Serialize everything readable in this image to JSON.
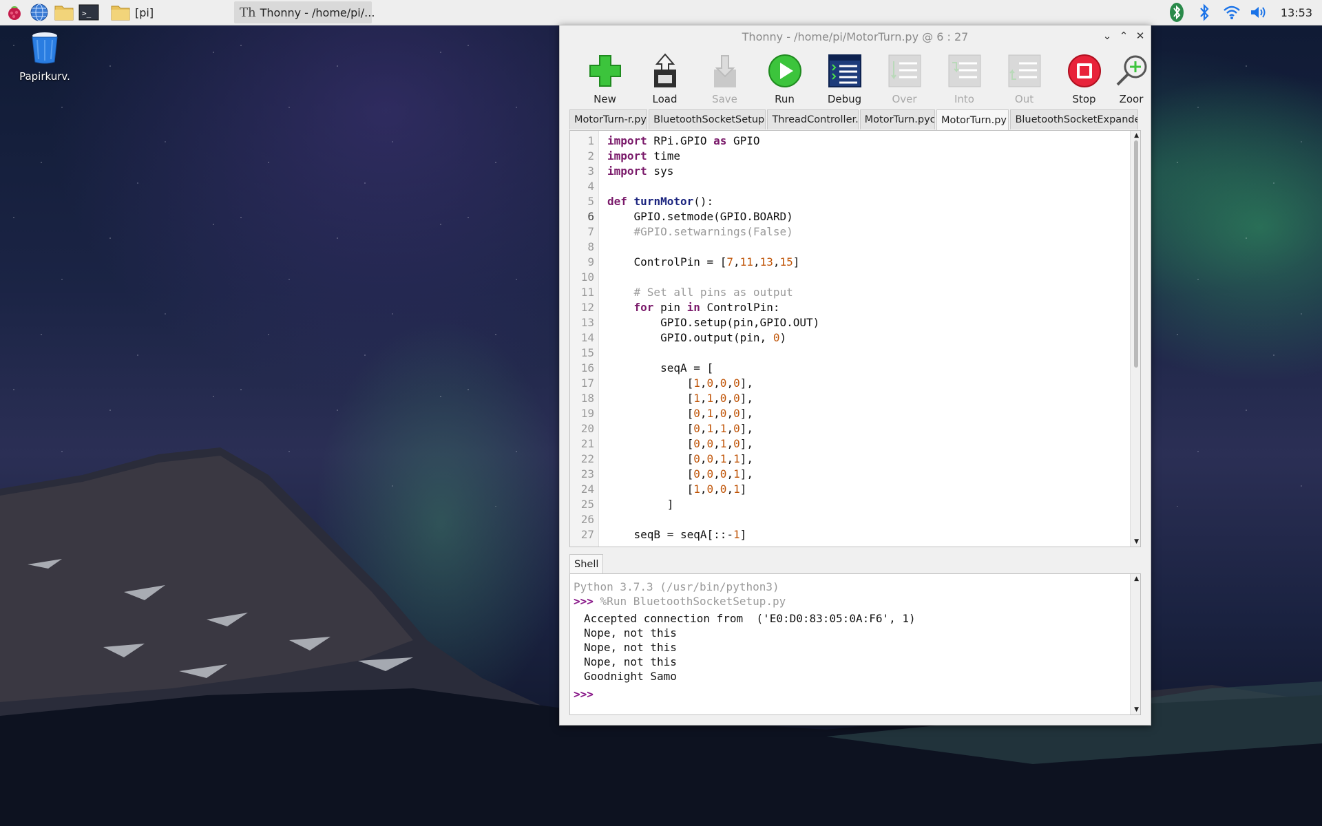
{
  "taskbar": {
    "folder_label": "[pi]",
    "task_label": "Thonny  -  /home/pi/...",
    "clock": "13:53",
    "icons": [
      "raspberry-menu-icon",
      "web-browser-icon",
      "file-manager-icon",
      "terminal-icon"
    ],
    "tray_icons": [
      "bluetooth-status-icon",
      "bluetooth-icon",
      "wifi-icon",
      "volume-icon"
    ]
  },
  "desktop": {
    "trash_label": "Papirkurv."
  },
  "window": {
    "title": "Thonny  -  /home/pi/MotorTurn.py  @  6 : 27",
    "toolbar": {
      "new": "New",
      "load": "Load",
      "save": "Save",
      "run": "Run",
      "debug": "Debug",
      "over": "Over",
      "into": "Into",
      "out": "Out",
      "stop": "Stop",
      "zoom": "Zoor"
    },
    "tabs": [
      "MotorTurn-r.py",
      "BluetoothSocketSetup.py",
      "ThreadController.p",
      "MotorTurn.pyc",
      "MotorTurn.py",
      "BluetoothSocketExpanded."
    ],
    "active_tab": 4,
    "line_numbers": [
      "1",
      "2",
      "3",
      "4",
      "5",
      "6",
      "7",
      "8",
      "9",
      "10",
      "11",
      "12",
      "13",
      "14",
      "15",
      "16",
      "17",
      "18",
      "19",
      "20",
      "21",
      "22",
      "23",
      "24",
      "25",
      "26",
      "27"
    ],
    "current_line": "6",
    "code_lines": [
      "import RPi.GPIO as GPIO",
      "import time",
      "import sys",
      "",
      "def turnMotor():",
      "    GPIO.setmode(GPIO.BOARD)",
      "    #GPIO.setwarnings(False)",
      "",
      "    ControlPin = [7,11,13,15]",
      "",
      "    # Set all pins as output",
      "    for pin in ControlPin:",
      "        GPIO.setup(pin,GPIO.OUT)",
      "        GPIO.output(pin, 0)",
      "",
      "        seqA = [",
      "            [1,0,0,0],",
      "            [1,1,0,0],",
      "            [0,1,0,0],",
      "            [0,1,1,0],",
      "            [0,0,1,0],",
      "            [0,0,1,1],",
      "            [0,0,0,1],",
      "            [1,0,0,1]",
      "         ]",
      "",
      "    seqB = seqA[::-1]"
    ],
    "shell": {
      "tab_label": "Shell",
      "version": "Python 3.7.3 (/usr/bin/python3)",
      "prompt": ">>>",
      "run_command": "%Run BluetoothSocketSetup.py",
      "output": [
        "Accepted connection from  ('E0:D0:83:05:0A:F6', 1)",
        "Nope, not this",
        "Nope, not this",
        "Nope, not this",
        "Goodnight Samo"
      ]
    }
  }
}
